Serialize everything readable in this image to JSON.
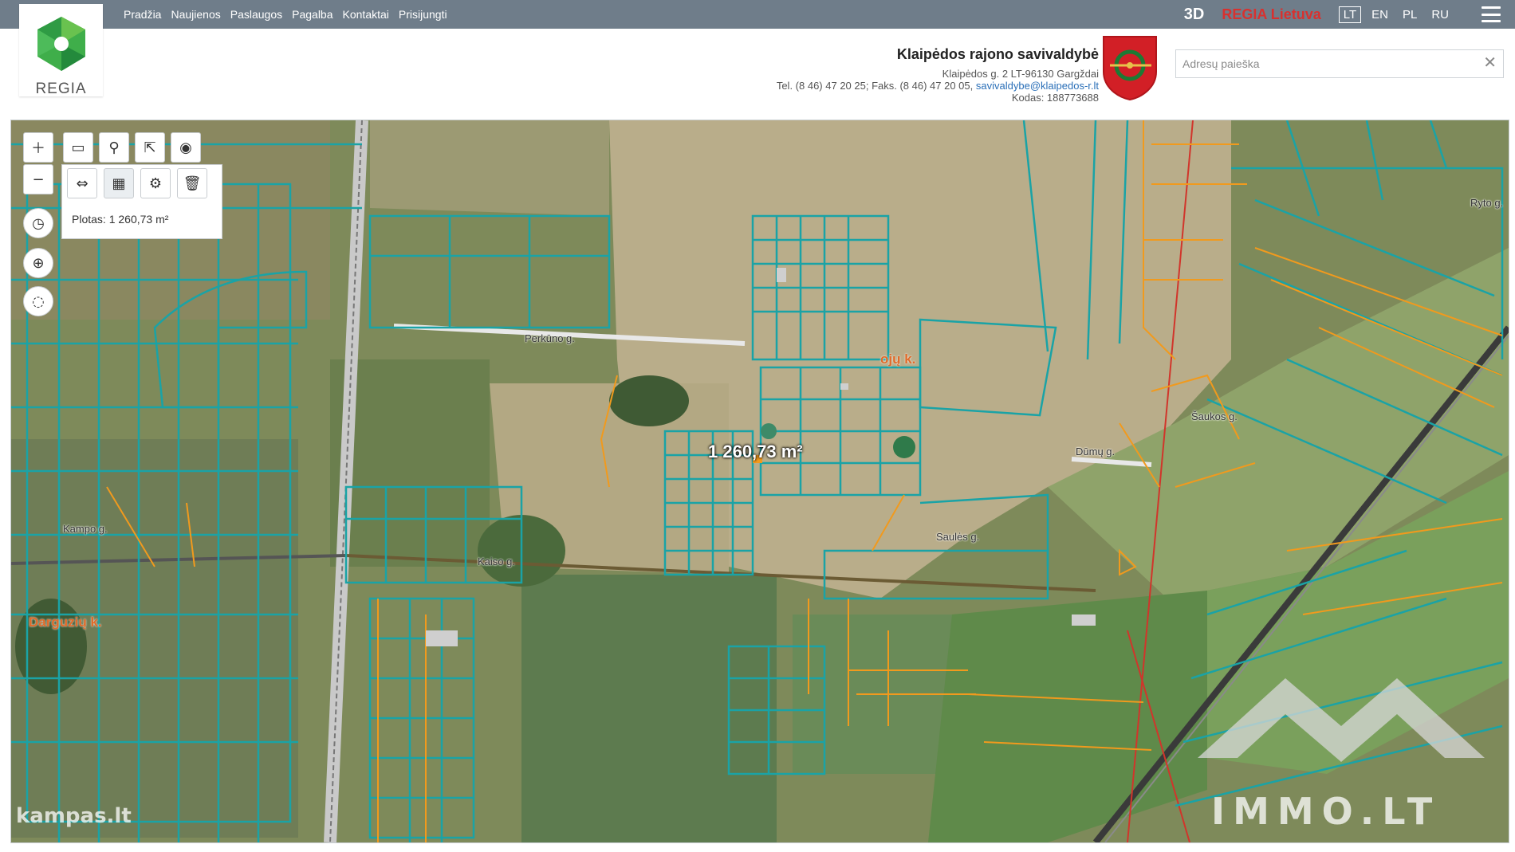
{
  "nav": [
    "Pradžia",
    "Naujienos",
    "Paslaugos",
    "Pagalba",
    "Kontaktai",
    "Prisijungti"
  ],
  "top_tools": {
    "btn3d": "3D",
    "regia_lietuva": "REGIA Lietuva"
  },
  "languages": [
    "LT",
    "EN",
    "PL",
    "RU"
  ],
  "active_language": "LT",
  "logo_text": "REGIA",
  "municipality": {
    "title": "Klaipėdos rajono savivaldybė",
    "address": "Klaipėdos g. 2 LT-96130 Gargždai",
    "phone_fax": "Tel. (8 46) 47 20 25; Faks. (8 46) 47 20 05,",
    "email": "savivaldybe@klaipedos-r.lt",
    "code": "Kodas: 188773688"
  },
  "search": {
    "placeholder": "Adresų paieška",
    "value": ""
  },
  "measurement": {
    "readout": "Plotas: 1 260,73 m²",
    "map_label": "1 260,73 m²"
  },
  "map_labels": {
    "perkuno": "Perkūno g.",
    "village_ojo": "ojų k.",
    "dumu": "Dūmų g.",
    "darguziu": "Darguzių k.",
    "kampo": "Kampo g.",
    "kaiso": "Kaiso g.",
    "sakuos": "Šaukos g.",
    "saules": "Saulės g.",
    "rygos": "Ryto g."
  },
  "watermarks": {
    "kampas": "kampas.lt",
    "immo": "IMMO.LT"
  },
  "colors": {
    "parcel_teal": "#1aa3a6",
    "parcel_orange": "#f19a1d",
    "power_line": "#d1352b",
    "field_light": "#b9ad8a",
    "field_green": "#5d7b4f"
  }
}
